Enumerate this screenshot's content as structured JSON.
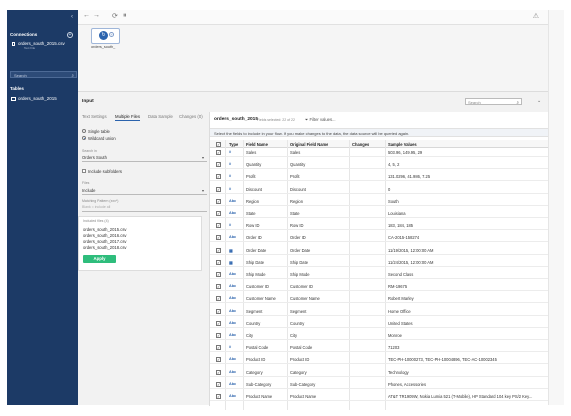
{
  "sidebar": {
    "collapse_glyph": "‹",
    "connections_title": "Connections",
    "add_glyph": "+",
    "connection": {
      "name": "orders_south_2015.csv",
      "sub": "Text File"
    },
    "search_placeholder": "Search",
    "tables_title": "Tables",
    "table": {
      "name": "orders_south_2015"
    }
  },
  "toolbar": {
    "back": "←",
    "forward": "→",
    "refresh": "⟳",
    "stop": "⏸",
    "alert": "⚠"
  },
  "flow": {
    "node_label": "orders_south_",
    "node_icon": "↻",
    "add_glyph": "+"
  },
  "input_panel": {
    "title": "Input",
    "search_placeholder": "Search",
    "collapse_glyph": "⌄",
    "tabs": [
      "Text Settings",
      "Multiple Files",
      "Data Sample",
      "Changes (0)"
    ],
    "options": [
      "Single table",
      "Wildcard union"
    ],
    "search_in_label": "Search in",
    "search_in_value": "Orders South",
    "include_subfolders": "Include subfolders",
    "files_label": "Files",
    "files_value": "Include",
    "matching_pattern_label": "Matching Pattern (xxx*)",
    "matching_pattern_value": "Blank = include all",
    "included_files_header": "Included files (4)",
    "included_files": [
      "orders_south_2015.csv",
      "orders_south_2016.csv",
      "orders_south_2017.csv",
      "orders_south_2018.csv"
    ],
    "apply_label": "Apply",
    "dropdown_glyph": "▾"
  },
  "table": {
    "name": "orders_south_2015",
    "fields_selected": "Fields selected: 22 of 22",
    "filter_label": "Filter values...",
    "instruction": "Select the fields to include in your flow. If you make changes to the data, the data source will be queried again.",
    "headers": [
      "Type",
      "Field Name",
      "Original Field Name",
      "Changes",
      "Sample Values"
    ],
    "rows": [
      {
        "type": "#",
        "field": "Sales",
        "original": "Sales",
        "changes": "",
        "sample": "503.96, 149.95, 29"
      },
      {
        "type": "#",
        "field": "Quantity",
        "original": "Quantity",
        "changes": "",
        "sample": "4, 5, 2"
      },
      {
        "type": "#",
        "field": "Profit",
        "original": "Profit",
        "changes": "",
        "sample": "131.0296, 41.986, 7.25"
      },
      {
        "type": "#",
        "field": "Discount",
        "original": "Discount",
        "changes": "",
        "sample": "0"
      },
      {
        "type": "Abc",
        "field": "Region",
        "original": "Region",
        "changes": "",
        "sample": "South"
      },
      {
        "type": "Abc",
        "field": "State",
        "original": "State",
        "changes": "",
        "sample": "Louisiana"
      },
      {
        "type": "#",
        "field": "Row ID",
        "original": "Row ID",
        "changes": "",
        "sample": "183, 184, 185"
      },
      {
        "type": "Abc",
        "field": "Order ID",
        "original": "Order ID",
        "changes": "",
        "sample": "CA-2015-158274"
      },
      {
        "type": "▦",
        "field": "Order Date",
        "original": "Order Date",
        "changes": "",
        "sample": "11/19/2015, 12:00:00 AM"
      },
      {
        "type": "▦",
        "field": "Ship Date",
        "original": "Ship Date",
        "changes": "",
        "sample": "11/24/2015, 12:00:00 AM"
      },
      {
        "type": "Abc",
        "field": "Ship Mode",
        "original": "Ship Mode",
        "changes": "",
        "sample": "Second Class"
      },
      {
        "type": "Abc",
        "field": "Customer ID",
        "original": "Customer ID",
        "changes": "",
        "sample": "RM-19675"
      },
      {
        "type": "Abc",
        "field": "Customer Name",
        "original": "Customer Name",
        "changes": "",
        "sample": "Robert Marley"
      },
      {
        "type": "Abc",
        "field": "Segment",
        "original": "Segment",
        "changes": "",
        "sample": "Home Office"
      },
      {
        "type": "Abc",
        "field": "Country",
        "original": "Country",
        "changes": "",
        "sample": "United States"
      },
      {
        "type": "Abc",
        "field": "City",
        "original": "City",
        "changes": "",
        "sample": "Monroe"
      },
      {
        "type": "#",
        "field": "Postal Code",
        "original": "Postal Code",
        "changes": "",
        "sample": "71203"
      },
      {
        "type": "Abc",
        "field": "Product ID",
        "original": "Product ID",
        "changes": "",
        "sample": "TEC-PH-10000273, TEC-PH-10004896, TEC-AC-10002345"
      },
      {
        "type": "Abc",
        "field": "Category",
        "original": "Category",
        "changes": "",
        "sample": "Technology"
      },
      {
        "type": "Abc",
        "field": "Sub-Category",
        "original": "Sub-Category",
        "changes": "",
        "sample": "Phones, Accessories"
      },
      {
        "type": "Abc",
        "field": "Product Name",
        "original": "Product Name",
        "changes": "",
        "sample": "AT&T TR1909W, Nokia Lumia 521 (T-Mobile), HP Standard 104 key PS/2 Key..."
      }
    ]
  },
  "colors": {
    "sidebar": "#1c3a66",
    "accent": "#2b63ad",
    "apply": "#2ebd7c"
  }
}
